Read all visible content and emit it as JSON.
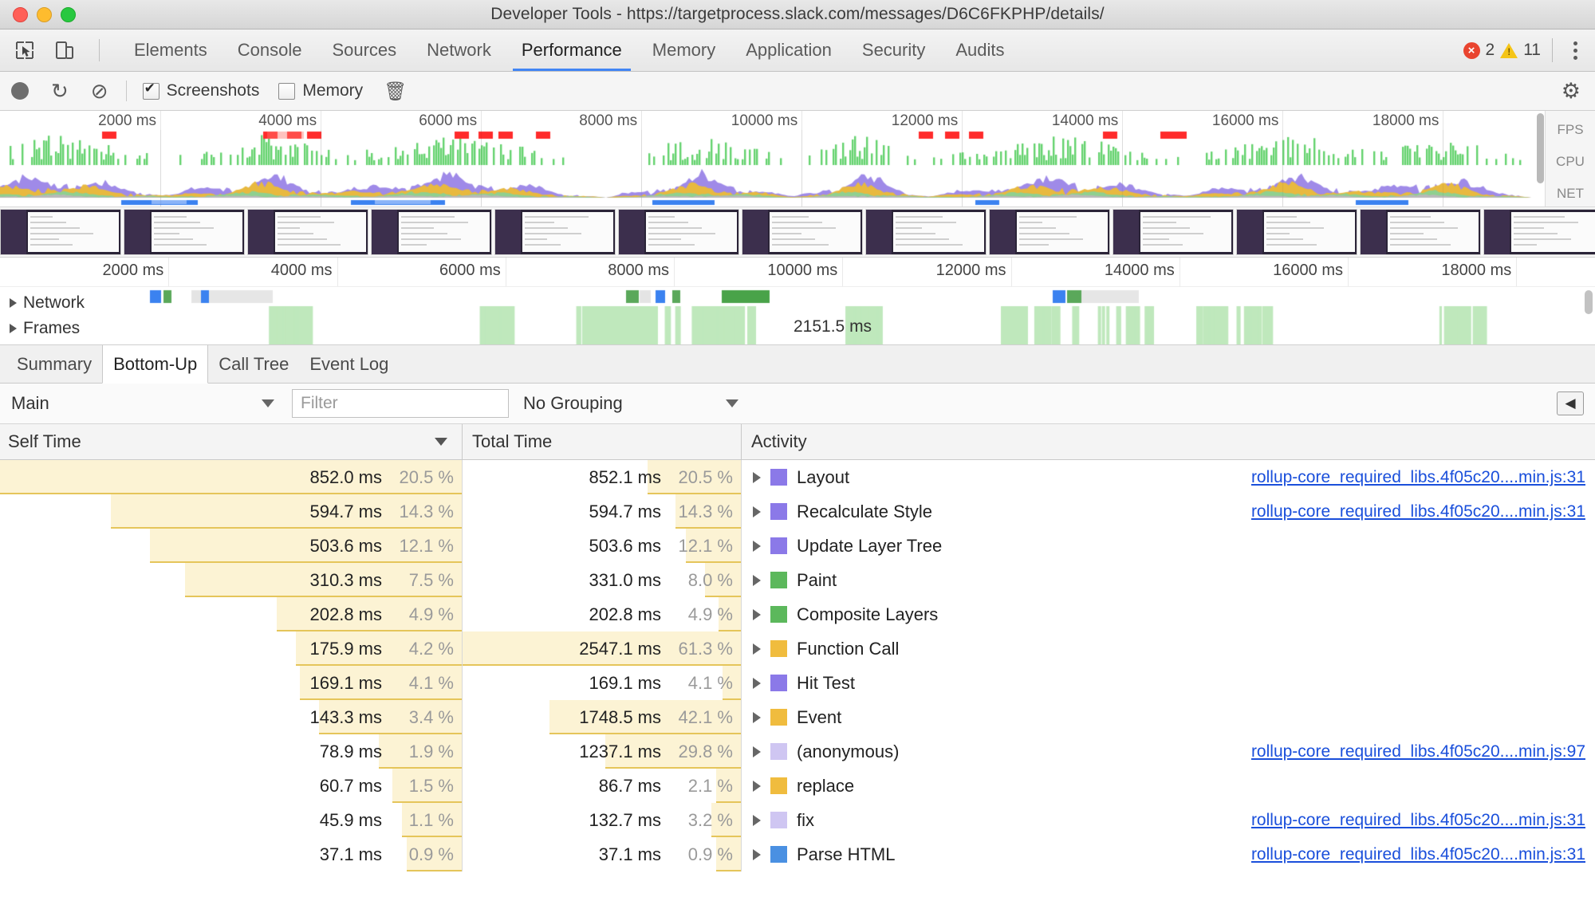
{
  "window": {
    "title": "Developer Tools - https://targetprocess.slack.com/messages/D6C6FKPHP/details/"
  },
  "main_tabs": [
    {
      "label": "Elements",
      "active": false
    },
    {
      "label": "Console",
      "active": false
    },
    {
      "label": "Sources",
      "active": false
    },
    {
      "label": "Network",
      "active": false
    },
    {
      "label": "Performance",
      "active": true
    },
    {
      "label": "Memory",
      "active": false
    },
    {
      "label": "Application",
      "active": false
    },
    {
      "label": "Security",
      "active": false
    },
    {
      "label": "Audits",
      "active": false
    }
  ],
  "status": {
    "error_count": "2",
    "warning_count": "11",
    "error_mark": "×"
  },
  "capture_toolbar": {
    "record_label": "record",
    "reload_label": "↻",
    "clear_label": "⊘",
    "screenshots_label": "Screenshots",
    "screenshots_checked": true,
    "memory_label": "Memory",
    "memory_checked": false,
    "trash_label": "🗑",
    "settings_label": "⚙"
  },
  "overview": {
    "ticks": [
      "2000 ms",
      "4000 ms",
      "6000 ms",
      "8000 ms",
      "10000 ms",
      "12000 ms",
      "14000 ms",
      "16000 ms",
      "18000 ms"
    ],
    "lane_labels": [
      "FPS",
      "CPU",
      "NET"
    ]
  },
  "timeline": {
    "ticks": [
      "2000 ms",
      "4000 ms",
      "6000 ms",
      "8000 ms",
      "10000 ms",
      "12000 ms",
      "14000 ms",
      "16000 ms",
      "18000 ms"
    ],
    "tracks": [
      {
        "label": "Network"
      },
      {
        "label": "Frames"
      }
    ],
    "frames_duration": "2151.5 ms"
  },
  "bottom_tabs": [
    {
      "label": "Summary",
      "active": false
    },
    {
      "label": "Bottom-Up",
      "active": true
    },
    {
      "label": "Call Tree",
      "active": false
    },
    {
      "label": "Event Log",
      "active": false
    }
  ],
  "filter_bar": {
    "scope": "Main",
    "filter_placeholder": "Filter",
    "grouping": "No Grouping",
    "collapse_icon": "◀"
  },
  "table": {
    "columns": [
      "Self Time",
      "Total Time",
      "Activity"
    ],
    "sorted_column": "Self Time",
    "sort_direction": "desc",
    "rows": [
      {
        "self_ms": "852.0 ms",
        "self_pct": "20.5 %",
        "self_bar": 100.0,
        "total_ms": "852.1 ms",
        "total_pct": "20.5 %",
        "total_bar": 33.5,
        "activity": "Layout",
        "color": "#8b79e8",
        "source": "rollup-core_required_libs.4f05c20....min.js:31"
      },
      {
        "self_ms": "594.7 ms",
        "self_pct": "14.3 %",
        "self_bar": 76.0,
        "total_ms": "594.7 ms",
        "total_pct": "14.3 %",
        "total_bar": 23.4,
        "activity": "Recalculate Style",
        "color": "#8b79e8",
        "source": "rollup-core_required_libs.4f05c20....min.js:31"
      },
      {
        "self_ms": "503.6 ms",
        "self_pct": "12.1 %",
        "self_bar": 67.5,
        "total_ms": "503.6 ms",
        "total_pct": "12.1 %",
        "total_bar": 19.8,
        "activity": "Update Layer Tree",
        "color": "#8b79e8",
        "source": ""
      },
      {
        "self_ms": "310.3 ms",
        "self_pct": "7.5 %",
        "self_bar": 60.0,
        "total_ms": "331.0 ms",
        "total_pct": "8.0 %",
        "total_bar": 13.0,
        "activity": "Paint",
        "color": "#5cb85c",
        "source": ""
      },
      {
        "self_ms": "202.8 ms",
        "self_pct": "4.9 %",
        "self_bar": 40.0,
        "total_ms": "202.8 ms",
        "total_pct": "4.9 %",
        "total_bar": 8.0,
        "activity": "Composite Layers",
        "color": "#5cb85c",
        "source": ""
      },
      {
        "self_ms": "175.9 ms",
        "self_pct": "4.2 %",
        "self_bar": 36.0,
        "total_ms": "2547.1 ms",
        "total_pct": "61.3 %",
        "total_bar": 100.0,
        "activity": "Function Call",
        "color": "#f0bc3e",
        "source": ""
      },
      {
        "self_ms": "169.1 ms",
        "self_pct": "4.1 %",
        "self_bar": 35.0,
        "total_ms": "169.1 ms",
        "total_pct": "4.1 %",
        "total_bar": 6.6,
        "activity": "Hit Test",
        "color": "#8b79e8",
        "source": ""
      },
      {
        "self_ms": "143.3 ms",
        "self_pct": "3.4 %",
        "self_bar": 31.0,
        "total_ms": "1748.5 ms",
        "total_pct": "42.1 %",
        "total_bar": 68.7,
        "activity": "Event",
        "color": "#f0bc3e",
        "source": ""
      },
      {
        "self_ms": "78.9 ms",
        "self_pct": "1.9 %",
        "self_bar": 18.0,
        "total_ms": "1237.1 ms",
        "total_pct": "29.8 %",
        "total_bar": 48.6,
        "activity": "(anonymous)",
        "color": "#cfc6f2",
        "source": "rollup-core_required_libs.4f05c20....min.js:97"
      },
      {
        "self_ms": "60.7 ms",
        "self_pct": "1.5 %",
        "self_bar": 15.0,
        "total_ms": "86.7 ms",
        "total_pct": "2.1 %",
        "total_bar": 9.0,
        "activity": "replace",
        "color": "#f0bc3e",
        "source": ""
      },
      {
        "self_ms": "45.9 ms",
        "self_pct": "1.1 %",
        "self_bar": 13.0,
        "total_ms": "132.7 ms",
        "total_pct": "3.2 %",
        "total_bar": 10.5,
        "activity": "fix",
        "color": "#cfc6f2",
        "source": "rollup-core_required_libs.4f05c20....min.js:31"
      },
      {
        "self_ms": "37.1 ms",
        "self_pct": "0.9 %",
        "self_bar": 12.0,
        "total_ms": "37.1 ms",
        "total_pct": "0.9 %",
        "total_bar": 9.0,
        "activity": "Parse HTML",
        "color": "#4a90e2",
        "source": "rollup-core_required_libs.4f05c20....min.js:31"
      }
    ]
  }
}
